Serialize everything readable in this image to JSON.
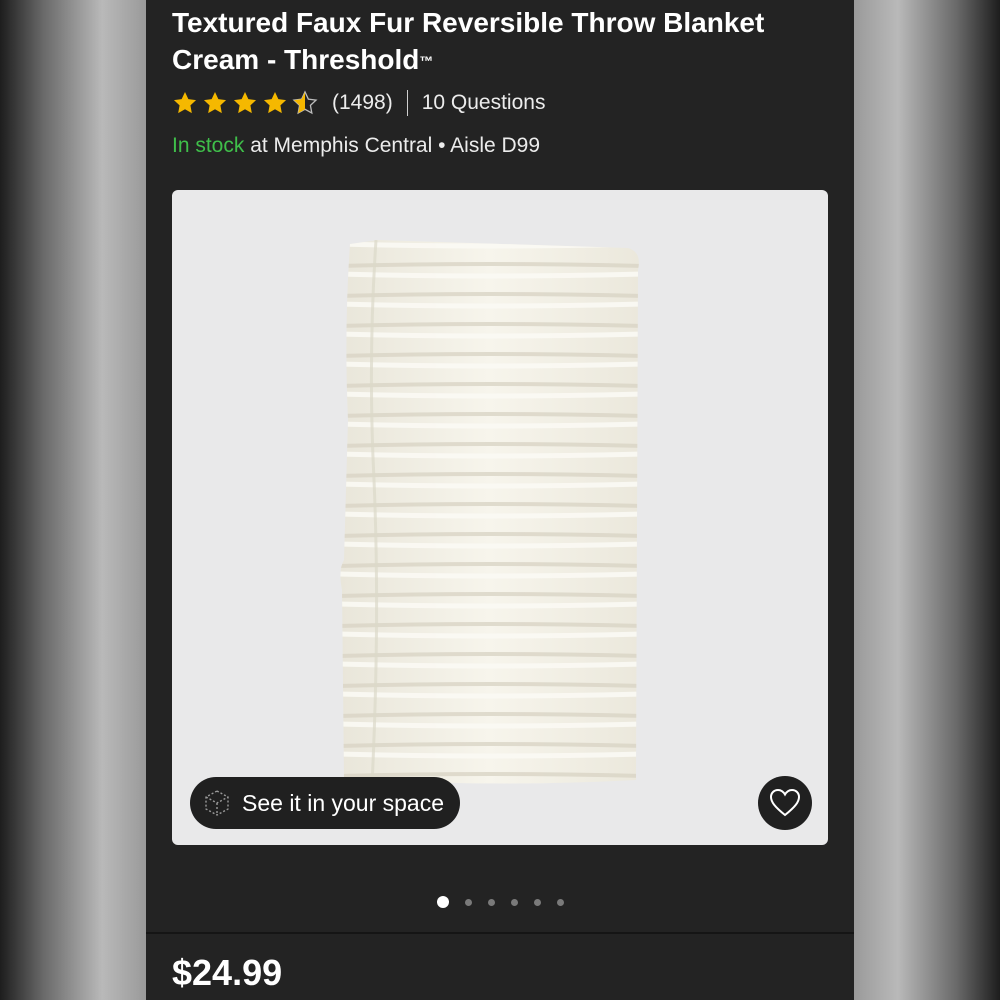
{
  "product": {
    "title": "Textured Faux Fur Reversible Throw Blanket Cream - Threshold",
    "trademark": "™",
    "rating": 4.5,
    "review_count": "(1498)",
    "questions": "10 Questions",
    "stock_status": "In stock",
    "stock_location": " at Memphis Central • Aisle D99",
    "price": "$24.99"
  },
  "gallery": {
    "ar_label": "See it in your space",
    "image_count": 6,
    "active_index": 0
  },
  "icons": {
    "star": "star-icon",
    "half_star": "half-star-icon",
    "ar": "cube-ar-icon",
    "favorite": "heart-icon"
  },
  "colors": {
    "background": "#232323",
    "star": "#f5b800",
    "in_stock": "#3fbf4a",
    "image_bg": "#e9e9ea"
  }
}
